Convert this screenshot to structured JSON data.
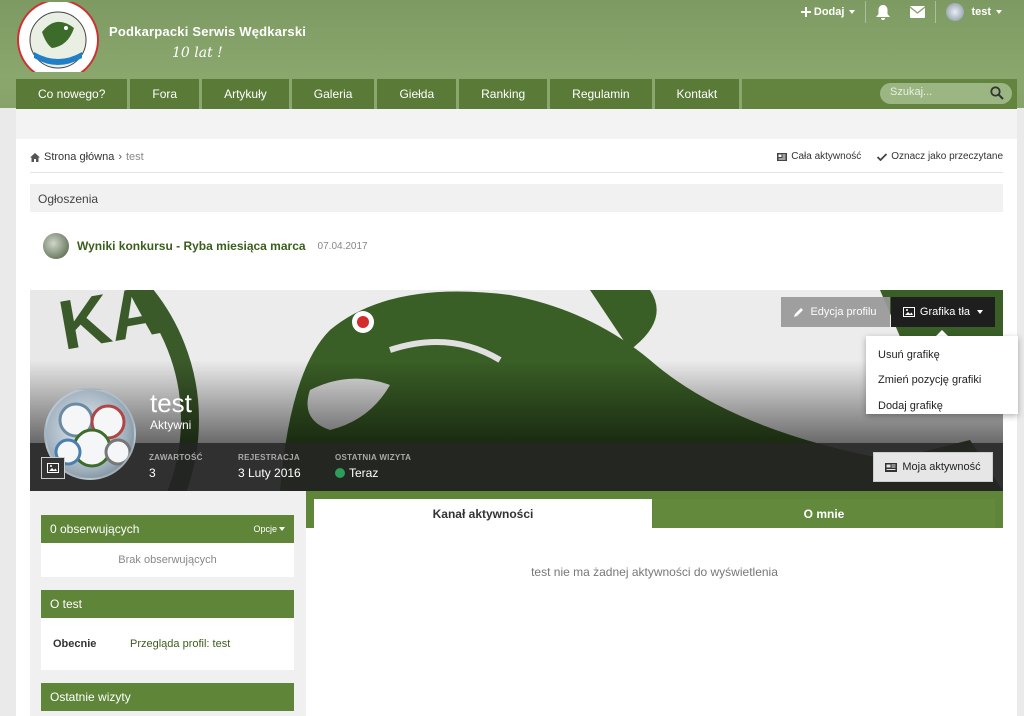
{
  "site": {
    "title": "Podkarpacki Serwis Wędkarski",
    "subtitle": "10 lat !",
    "logo_icon": "fishing-club-logo"
  },
  "userbar": {
    "add_label": "Dodaj",
    "username": "test"
  },
  "nav": {
    "items": [
      "Co nowego?",
      "Fora",
      "Artykuły",
      "Galeria",
      "Giełda",
      "Ranking",
      "Regulamin",
      "Kontakt"
    ],
    "search_placeholder": "Szukaj..."
  },
  "breadcrumb": {
    "home": "Strona główna",
    "current": "test"
  },
  "page_actions": {
    "all_activity": "Cała aktywność",
    "mark_read": "Oznacz jako przeczytane"
  },
  "announcements": {
    "header": "Ogłoszenia",
    "item_title": "Wyniki konkursu - Ryba miesiąca marca",
    "item_date": "07.04.2017"
  },
  "profile": {
    "name": "test",
    "status": "Aktywni",
    "edit_label": "Edycja profilu",
    "cover_label": "Grafika tła",
    "cover_menu": [
      "Usuń grafikę",
      "Zmień pozycję grafiki",
      "Dodaj grafikę"
    ],
    "stats": [
      {
        "label": "ZAWARTOŚĆ",
        "value": "3"
      },
      {
        "label": "REJESTRACJA",
        "value": "3 Luty 2016"
      },
      {
        "label": "OSTATNIA WIZYTA",
        "value": "Teraz"
      }
    ],
    "activity_button": "Moja aktywność"
  },
  "sidebar": {
    "followers_title": "0 obserwujących",
    "options_label": "Opcje",
    "followers_empty": "Brak obserwujących",
    "about_title": "O test",
    "about_key": "Obecnie",
    "about_value": "Przegląda profil: test",
    "recent_title": "Ostatnie wizyty"
  },
  "tabs": {
    "feed": "Kanał aktywności",
    "about": "O mnie"
  },
  "feed": {
    "empty": "test nie ma żadnej aktywności do wyświetlenia"
  },
  "colors": {
    "header": "#87a36b",
    "nav": "#5a7b38",
    "accent": "#5f8539",
    "link": "#3a5e1c",
    "online": "#2e9c5a"
  }
}
